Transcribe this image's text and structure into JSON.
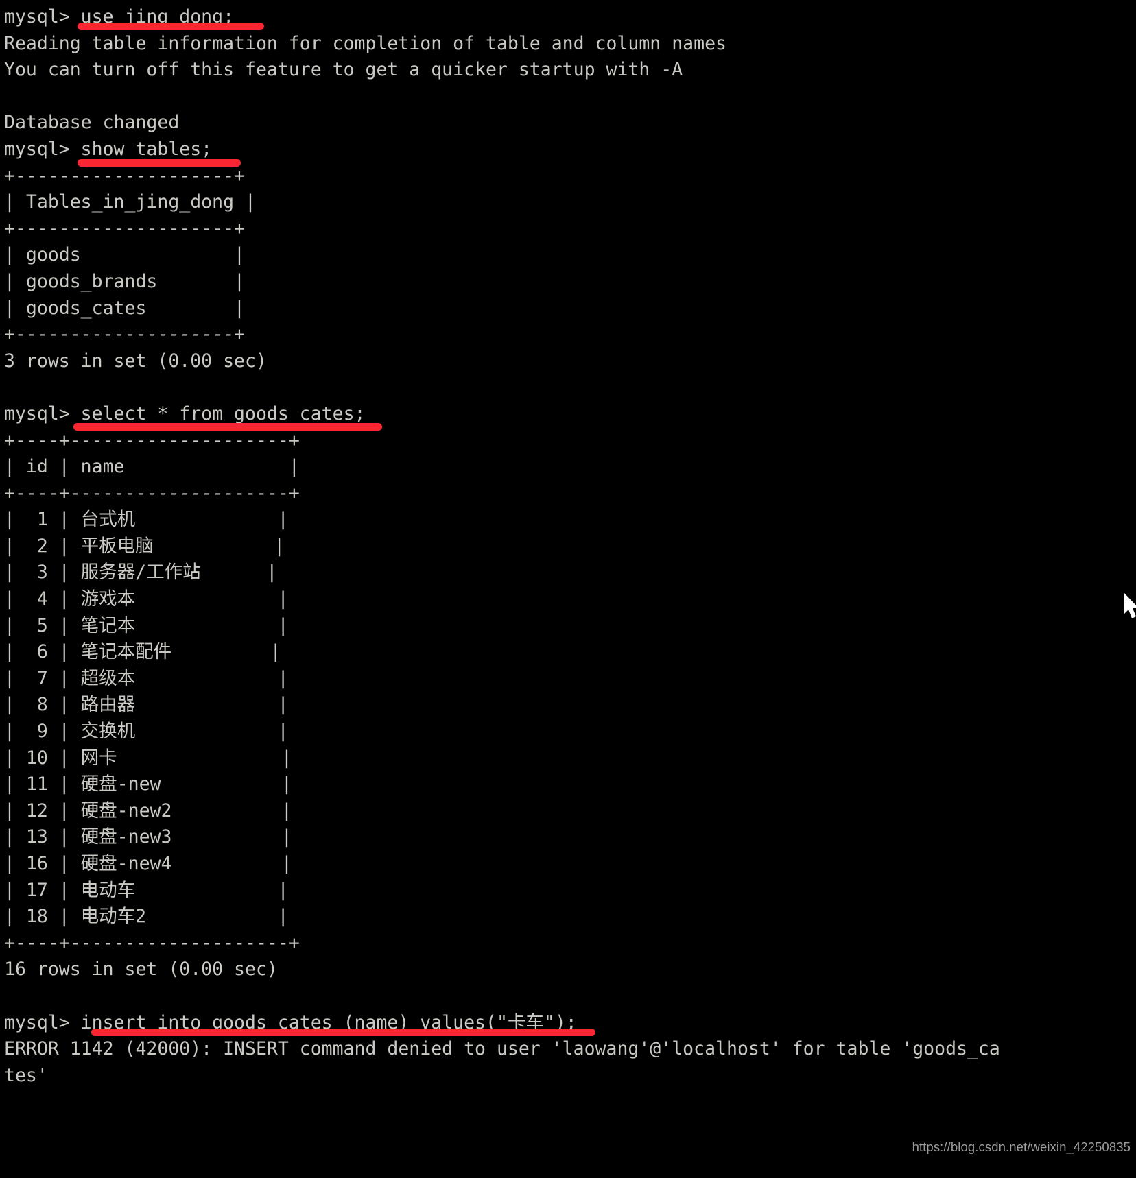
{
  "terminal": {
    "prompt": "mysql> ",
    "foreground_color": "#cbc9c3",
    "background_color": "#000000",
    "annotation_color": "#fa2733",
    "lines": [
      "mysql> use jing_dong;",
      "Reading table information for completion of table and column names",
      "You can turn off this feature to get a quicker startup with -A",
      "",
      "Database changed",
      "mysql> show tables;",
      "+--------------------+",
      "| Tables_in_jing_dong |",
      "+--------------------+",
      "| goods              |",
      "| goods_brands       |",
      "| goods_cates        |",
      "+--------------------+",
      "3 rows in set (0.00 sec)",
      "",
      "mysql> select * from goods_cates;",
      "+----+--------------------+",
      "| id | name               |",
      "+----+--------------------+",
      "|  1 | 台式机             |",
      "|  2 | 平板电脑           |",
      "|  3 | 服务器/工作站      |",
      "|  4 | 游戏本             |",
      "|  5 | 笔记本             |",
      "|  6 | 笔记本配件         |",
      "|  7 | 超级本             |",
      "|  8 | 路由器             |",
      "|  9 | 交换机             |",
      "| 10 | 网卡               |",
      "| 11 | 硬盘-new           |",
      "| 12 | 硬盘-new2          |",
      "| 13 | 硬盘-new3          |",
      "| 16 | 硬盘-new4          |",
      "| 17 | 电动车             |",
      "| 18 | 电动车2            |",
      "+----+--------------------+",
      "16 rows in set (0.00 sec)",
      "",
      "mysql> insert into goods_cates (name) values(\"卡车\");",
      "ERROR 1142 (42000): INSERT command denied to user 'laowang'@'localhost' for table 'goods_ca",
      "tes'"
    ],
    "commands": [
      {
        "label": "use jing_dong;",
        "sql": "use jing_dong;"
      },
      {
        "label": "show tables;",
        "sql": "show tables;"
      },
      {
        "label": "select * from goods_cates;",
        "sql": "select * from goods_cates;"
      },
      {
        "label": "insert into goods_cates (name) values(\"卡车\");",
        "sql": "insert into goods_cates (name) values(\"卡车\");"
      }
    ],
    "results": {
      "database_changed": "Database changed",
      "tables_header": "Tables_in_jing_dong",
      "tables": [
        "goods",
        "goods_brands",
        "goods_cates"
      ],
      "tables_rowcount": "3 rows in set (0.00 sec)",
      "cates_columns": [
        "id",
        "name"
      ],
      "cates_rows": [
        {
          "id": "1",
          "name": "台式机"
        },
        {
          "id": "2",
          "name": "平板电脑"
        },
        {
          "id": "3",
          "name": "服务器/工作站"
        },
        {
          "id": "4",
          "name": "游戏本"
        },
        {
          "id": "5",
          "name": "笔记本"
        },
        {
          "id": "6",
          "name": "笔记本配件"
        },
        {
          "id": "7",
          "name": "超级本"
        },
        {
          "id": "8",
          "name": "路由器"
        },
        {
          "id": "9",
          "name": "交换机"
        },
        {
          "id": "10",
          "name": "网卡"
        },
        {
          "id": "11",
          "name": "硬盘-new"
        },
        {
          "id": "12",
          "name": "硬盘-new2"
        },
        {
          "id": "13",
          "name": "硬盘-new3"
        },
        {
          "id": "16",
          "name": "硬盘-new4"
        },
        {
          "id": "17",
          "name": "电动车"
        },
        {
          "id": "18",
          "name": "电动车2"
        }
      ],
      "cates_rowcount": "16 rows in set (0.00 sec)",
      "error": "ERROR 1142 (42000): INSERT command denied to user 'laowang'@'localhost' for table 'goods_cates'"
    },
    "notices": [
      "Reading table information for completion of table and column names",
      "You can turn off this feature to get a quicker startup with -A"
    ]
  },
  "watermark": {
    "text": "https://blog.csdn.net/weixin_42250835"
  },
  "annotations": [
    {
      "name": "underline-use-jing-dong",
      "target": "use jing_dong;"
    },
    {
      "name": "underline-show-tables",
      "target": "show tables;"
    },
    {
      "name": "underline-select-goods-cates",
      "target": "select * from goods_cates;"
    },
    {
      "name": "underline-insert-goods-cates",
      "target": "insert into goods_cates (name) values(\"卡车\");"
    }
  ],
  "icons": {
    "cursor": "mouse-pointer-icon"
  }
}
